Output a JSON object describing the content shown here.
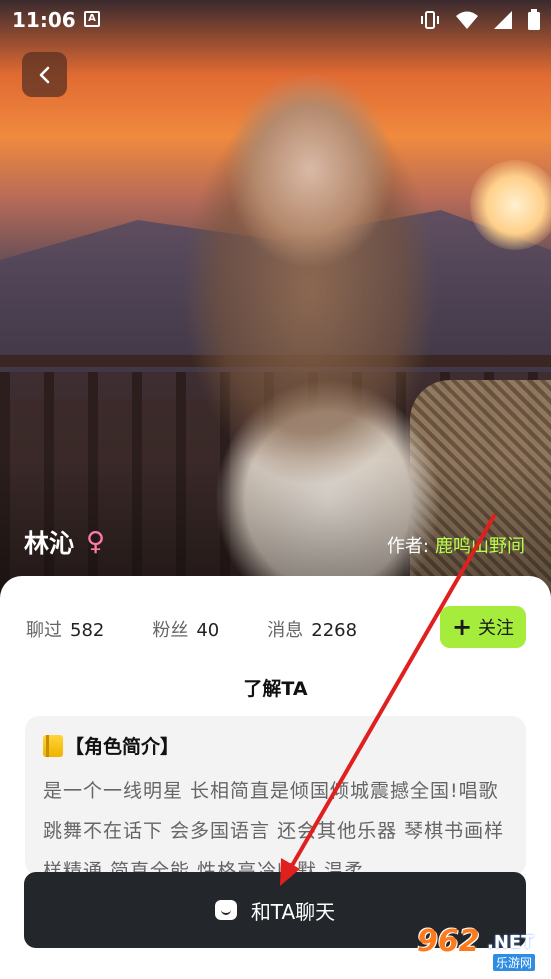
{
  "status_bar": {
    "time": "11:06",
    "app_icon_letter": "A"
  },
  "profile": {
    "name": "林沁",
    "gender_symbol": "♀",
    "author_label": "作者:",
    "author_name": "鹿鸣山野间"
  },
  "stats": [
    {
      "label": "聊过",
      "value": "582"
    },
    {
      "label": "粉丝",
      "value": "40"
    },
    {
      "label": "消息",
      "value": "2268"
    }
  ],
  "follow_button": {
    "plus": "+",
    "label": "关注"
  },
  "section_title": "了解TA",
  "intro": {
    "heading": "【角色简介】",
    "text": "是一个一线明星 长相简直是倾国倾城震撼全国!唱歌跳舞不在话下 会多国语言 还会其他乐器 琴棋书画样样精通 简直全能 性格高冷幽默 温柔"
  },
  "chat_button": {
    "label": "和TA聊天"
  },
  "watermark": {
    "number": "962",
    "suffix": ".NET",
    "site": "乐游网"
  },
  "colors": {
    "accent_green": "#a6ec3c",
    "author_green": "#b6ff4a",
    "dark_button": "#23262b",
    "arrow_red": "#e01f1f"
  }
}
